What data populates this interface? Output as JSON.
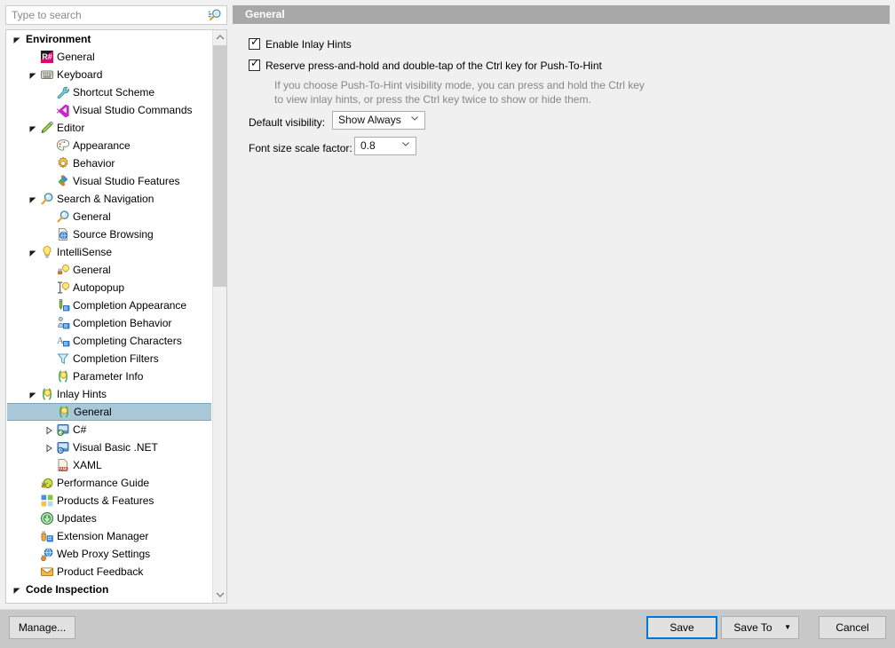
{
  "window": {
    "background": "#f0f0f0",
    "header_bg": "#a8a8a8",
    "selection_bg": "#a8c8d8",
    "focus_border": "#0078d7"
  },
  "search": {
    "placeholder": "Type to search",
    "value": "",
    "icon": "search-icon"
  },
  "tree": {
    "items": [
      {
        "label": "Environment",
        "depth": 0,
        "twisty": "expanded",
        "icon": "none",
        "bold": true,
        "selected": false
      },
      {
        "label": "General",
        "depth": 1,
        "twisty": "none",
        "icon": "resharper-icon",
        "bold": false,
        "selected": false
      },
      {
        "label": "Keyboard",
        "depth": 1,
        "twisty": "expanded",
        "icon": "keyboard-icon",
        "bold": false,
        "selected": false
      },
      {
        "label": "Shortcut Scheme",
        "depth": 2,
        "twisty": "none",
        "icon": "wrench-icon",
        "bold": false,
        "selected": false
      },
      {
        "label": "Visual Studio Commands",
        "depth": 2,
        "twisty": "none",
        "icon": "visual-studio-icon",
        "bold": false,
        "selected": false
      },
      {
        "label": "Editor",
        "depth": 1,
        "twisty": "expanded",
        "icon": "pencil-icon",
        "bold": false,
        "selected": false
      },
      {
        "label": "Appearance",
        "depth": 2,
        "twisty": "none",
        "icon": "palette-icon",
        "bold": false,
        "selected": false
      },
      {
        "label": "Behavior",
        "depth": 2,
        "twisty": "none",
        "icon": "gear-icon",
        "bold": false,
        "selected": false
      },
      {
        "label": "Visual Studio Features",
        "depth": 2,
        "twisty": "none",
        "icon": "puzzle-icon",
        "bold": false,
        "selected": false
      },
      {
        "label": "Search & Navigation",
        "depth": 1,
        "twisty": "expanded",
        "icon": "magnifier-icon",
        "bold": false,
        "selected": false
      },
      {
        "label": "General",
        "depth": 2,
        "twisty": "none",
        "icon": "magnifier-icon",
        "bold": false,
        "selected": false
      },
      {
        "label": "Source Browsing",
        "depth": 2,
        "twisty": "none",
        "icon": "globe-page-icon",
        "bold": false,
        "selected": false
      },
      {
        "label": "IntelliSense",
        "depth": 1,
        "twisty": "expanded",
        "icon": "lightbulb-icon",
        "bold": false,
        "selected": false
      },
      {
        "label": "General",
        "depth": 2,
        "twisty": "none",
        "icon": "plug-bulb-icon",
        "bold": false,
        "selected": false
      },
      {
        "label": "Autopopup",
        "depth": 2,
        "twisty": "none",
        "icon": "caret-bulb-icon",
        "bold": false,
        "selected": false
      },
      {
        "label": "Completion Appearance",
        "depth": 2,
        "twisty": "none",
        "icon": "pencil-list-icon",
        "bold": false,
        "selected": false
      },
      {
        "label": "Completion Behavior",
        "depth": 2,
        "twisty": "none",
        "icon": "pawn-list-icon",
        "bold": false,
        "selected": false
      },
      {
        "label": "Completing Characters",
        "depth": 2,
        "twisty": "none",
        "icon": "letter-a-list-icon",
        "bold": false,
        "selected": false
      },
      {
        "label": "Completion Filters",
        "depth": 2,
        "twisty": "none",
        "icon": "funnel-icon",
        "bold": false,
        "selected": false
      },
      {
        "label": "Parameter Info",
        "depth": 2,
        "twisty": "none",
        "icon": "parens-bulb-icon",
        "bold": false,
        "selected": false
      },
      {
        "label": "Inlay Hints",
        "depth": 1,
        "twisty": "expanded",
        "icon": "parens-bulb-icon",
        "bold": false,
        "selected": false
      },
      {
        "label": "General",
        "depth": 2,
        "twisty": "none",
        "icon": "parens-bulb-icon",
        "bold": false,
        "selected": true
      },
      {
        "label": "C#",
        "depth": 2,
        "twisty": "collapsed",
        "icon": "csharp-icon",
        "bold": false,
        "selected": false
      },
      {
        "label": "Visual Basic .NET",
        "depth": 2,
        "twisty": "collapsed",
        "icon": "vb-icon",
        "bold": false,
        "selected": false
      },
      {
        "label": "XAML",
        "depth": 2,
        "twisty": "none",
        "icon": "xaml-icon",
        "bold": false,
        "selected": false
      },
      {
        "label": "Performance Guide",
        "depth": 1,
        "twisty": "none",
        "icon": "snail-icon",
        "bold": false,
        "selected": false
      },
      {
        "label": "Products & Features",
        "depth": 1,
        "twisty": "none",
        "icon": "products-icon",
        "bold": false,
        "selected": false
      },
      {
        "label": "Updates",
        "depth": 1,
        "twisty": "none",
        "icon": "updates-icon",
        "bold": false,
        "selected": false
      },
      {
        "label": "Extension Manager",
        "depth": 1,
        "twisty": "none",
        "icon": "extension-icon",
        "bold": false,
        "selected": false
      },
      {
        "label": "Web Proxy Settings",
        "depth": 1,
        "twisty": "none",
        "icon": "web-proxy-icon",
        "bold": false,
        "selected": false
      },
      {
        "label": "Product Feedback",
        "depth": 1,
        "twisty": "none",
        "icon": "envelope-icon",
        "bold": false,
        "selected": false
      },
      {
        "label": "Code Inspection",
        "depth": 0,
        "twisty": "expanded",
        "icon": "none",
        "bold": true,
        "selected": false
      }
    ],
    "scrollbar": {
      "up_icon": "chevron-up-icon",
      "down_icon": "chevron-down-icon"
    }
  },
  "panel": {
    "title": "General",
    "checkboxes": [
      {
        "label": "Enable Inlay Hints",
        "checked": true
      },
      {
        "label": "Reserve press-and-hold and double-tap of the Ctrl key for Push-To-Hint",
        "checked": true
      }
    ],
    "hint_lines": [
      "If you choose Push-To-Hint visibility mode, you can press and hold the Ctrl key",
      "to view inlay hints, or press the Ctrl key twice to show or hide them."
    ],
    "fields": [
      {
        "label": "Default visibility:",
        "value": "Show Always",
        "arrow": "chevron-down-icon"
      },
      {
        "label": "Font size scale factor:",
        "value": "0.8",
        "arrow": "chevron-down-icon"
      }
    ]
  },
  "footer": {
    "manage_label": "Manage...",
    "save_label": "Save",
    "save_to_label": "Save To",
    "save_to_arrow": "caret-down-icon",
    "cancel_label": "Cancel"
  }
}
